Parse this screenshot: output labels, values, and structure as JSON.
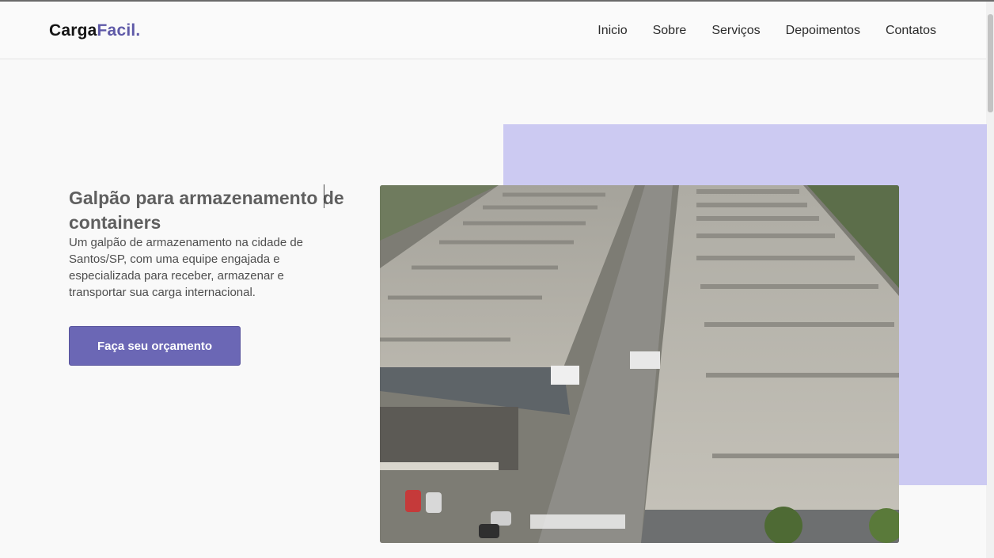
{
  "brand": {
    "name_part1": "Carga",
    "name_part2": "Facil."
  },
  "nav": {
    "items": [
      "Inicio",
      "Sobre",
      "Serviços",
      "Depoimentos",
      "Contatos"
    ]
  },
  "hero": {
    "title": "Galpão para armazenamento de containers",
    "description": "Um galpão de armazenamento na cidade de Santos/SP, com uma equipe engajada e especializada para receber, armazenar e transportar sua carga internacional.",
    "cta_label": "Faça seu orçamento"
  },
  "colors": {
    "accent": "#6b67b5",
    "accent_light": "#cccaf2",
    "text": "#5f5f5f"
  }
}
